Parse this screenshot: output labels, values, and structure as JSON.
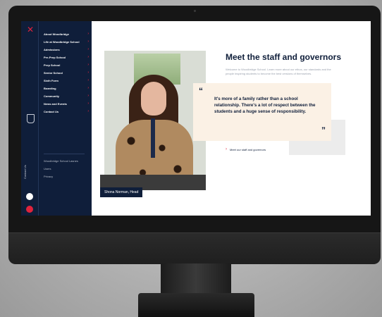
{
  "sidebar": {
    "close_icon": "close-icon",
    "vertical_label": "Contact Us",
    "menu": [
      "About Woodbridge",
      "Life at Woodbridge School",
      "Admissions",
      "Pre-Prep School",
      "Prep School",
      "Senior School",
      "Sixth Form",
      "Boarding",
      "Community",
      "News and Events",
      "Contact Us"
    ],
    "footer_links": [
      "Woodbridge School Lasnes",
      "Users",
      "Privacy"
    ]
  },
  "main": {
    "title": "Meet the staff and governors",
    "intro": "Welcome to Woodbridge School. Learn more about our ethos, our standards and the people inspiring students to become the best versions of themselves.",
    "quote": "It's more of a family rather than a school relationship. There's a lot of respect between the students and a huge sense of responsibility.",
    "quote_open": "“",
    "quote_close": "”",
    "photo_caption": "Shona Norman, Head",
    "link": "Meet our staff and governors",
    "chevron": "›"
  },
  "colors": {
    "navy": "#0f1e3a",
    "accent": "#e0233c",
    "quote_bg": "#fbf1e5"
  }
}
